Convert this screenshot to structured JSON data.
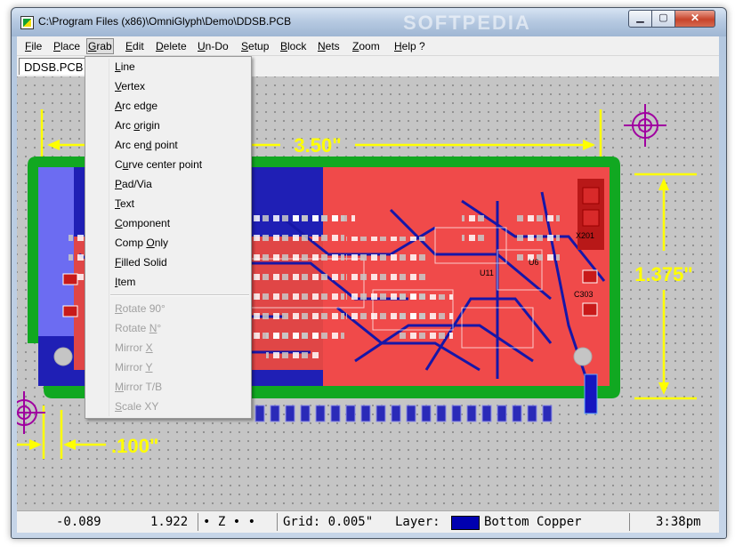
{
  "window": {
    "title": "C:\\Program Files (x86)\\OmniGlyph\\Demo\\DDSB.PCB",
    "watermark": "SOFTPEDIA"
  },
  "menubar": [
    {
      "label": "File",
      "accel": "F",
      "rest": "ile"
    },
    {
      "label": "Place",
      "accel": "P",
      "rest": "lace"
    },
    {
      "label": "Grab",
      "accel": "G",
      "rest": "rab"
    },
    {
      "label": "Edit",
      "accel": "E",
      "rest": "dit"
    },
    {
      "label": "Delete",
      "accel": "D",
      "rest": "elete"
    },
    {
      "label": "Un-Do",
      "accel": "U",
      "rest": "n-Do"
    },
    {
      "label": "Setup",
      "accel": "S",
      "rest": "etup"
    },
    {
      "label": "Block",
      "accel": "B",
      "rest": "lock"
    },
    {
      "label": "Nets",
      "accel": "N",
      "rest": "ets"
    },
    {
      "label": "Zoom",
      "accel": "Z",
      "rest": "oom"
    },
    {
      "label": "Help ?",
      "accel": "H",
      "rest": "elp ?"
    }
  ],
  "document_tab": "DDSB.PCB",
  "grab_menu": {
    "enabled": [
      {
        "pre": "",
        "accel": "L",
        "post": "ine"
      },
      {
        "pre": "",
        "accel": "V",
        "post": "ertex"
      },
      {
        "pre": "",
        "accel": "A",
        "post": "rc edge"
      },
      {
        "pre": "Arc ",
        "accel": "o",
        "post": "rigin"
      },
      {
        "pre": "Arc en",
        "accel": "d",
        "post": " point"
      },
      {
        "pre": "C",
        "accel": "u",
        "post": "rve center point"
      },
      {
        "pre": "",
        "accel": "P",
        "post": "ad/Via"
      },
      {
        "pre": "",
        "accel": "T",
        "post": "ext"
      },
      {
        "pre": "",
        "accel": "C",
        "post": "omponent"
      },
      {
        "pre": "Comp ",
        "accel": "O",
        "post": "nly"
      },
      {
        "pre": "",
        "accel": "F",
        "post": "illed Solid"
      },
      {
        "pre": "",
        "accel": "I",
        "post": "tem"
      }
    ],
    "disabled": [
      {
        "pre": "",
        "accel": "R",
        "post": "otate 90°"
      },
      {
        "pre": "Rotate ",
        "accel": "N",
        "post": "°"
      },
      {
        "pre": "Mirror ",
        "accel": "X",
        "post": ""
      },
      {
        "pre": "Mirror ",
        "accel": "Y",
        "post": ""
      },
      {
        "pre": "",
        "accel": "M",
        "post": "irror T/B"
      },
      {
        "pre": "",
        "accel": "S",
        "post": "cale XY"
      }
    ]
  },
  "board": {
    "width_label": "3.50\"",
    "height_label": "1.375\"",
    "offset_label": ".100\"",
    "ref_labels": [
      "X201",
      "C303",
      "U11",
      "U6"
    ],
    "colors": {
      "outline": "#11a821",
      "top_copper": "#f04a4a",
      "bottom_copper": "#1616a8",
      "dimension": "#ffff00",
      "target": "#a000a0",
      "silkscreen": "#ffffff"
    }
  },
  "status": {
    "x": "-0.089",
    "y": "1.922",
    "mode": "• Z • •",
    "grid": "Grid: 0.005\"",
    "layer_label": "Layer:",
    "layer_name": "Bottom Copper",
    "layer_color": "#0000b0",
    "time": "3:38pm"
  }
}
